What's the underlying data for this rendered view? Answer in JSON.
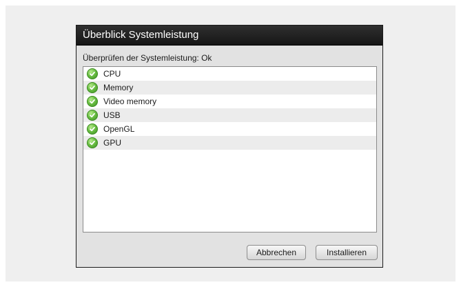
{
  "dialog": {
    "title": "Überblick Systemleistung",
    "status": "Überprüfen der Systemleistung: Ok"
  },
  "checks": [
    {
      "label": "CPU",
      "icon": "check-icon",
      "status": "ok"
    },
    {
      "label": "Memory",
      "icon": "check-icon",
      "status": "ok"
    },
    {
      "label": "Video memory",
      "icon": "check-icon",
      "status": "ok"
    },
    {
      "label": "USB",
      "icon": "check-icon",
      "status": "ok"
    },
    {
      "label": "OpenGL",
      "icon": "check-icon",
      "status": "ok"
    },
    {
      "label": "GPU",
      "icon": "check-icon",
      "status": "ok"
    }
  ],
  "buttons": {
    "cancel": "Abbrechen",
    "install": "Installieren"
  },
  "colors": {
    "titlebar": "#1f1f1f",
    "check_green": "#6cc045",
    "dialog_bg": "#e2e2e2"
  }
}
